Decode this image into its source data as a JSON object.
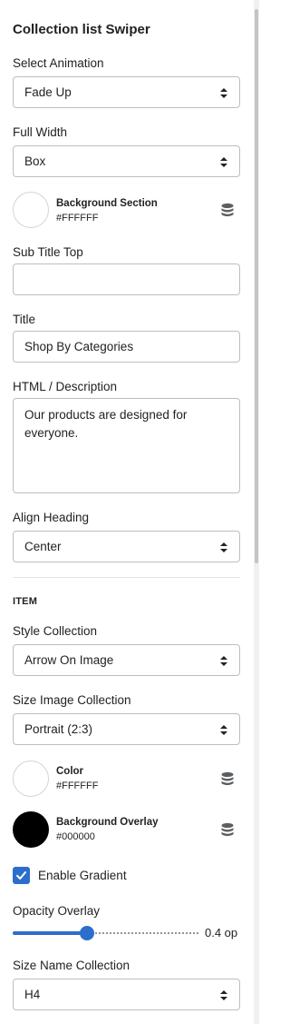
{
  "panel": {
    "title": "Collection list Swiper",
    "select_animation": {
      "label": "Select Animation",
      "value": "Fade Up"
    },
    "full_width": {
      "label": "Full Width",
      "value": "Box"
    },
    "background_section": {
      "label": "Background Section",
      "hex": "#FFFFFF",
      "color": "#ffffff"
    },
    "sub_title_top": {
      "label": "Sub Title Top",
      "value": ""
    },
    "title_field": {
      "label": "Title",
      "value": "Shop By Categories"
    },
    "html_description": {
      "label": "HTML / Description",
      "value": "Our products are designed for everyone."
    },
    "align_heading": {
      "label": "Align Heading",
      "value": "Center"
    },
    "item_section": "ITEM",
    "style_collection": {
      "label": "Style Collection",
      "value": "Arrow On Image"
    },
    "size_image_collection": {
      "label": "Size Image Collection",
      "value": "Portrait (2:3)"
    },
    "color": {
      "label": "Color",
      "hex": "#FFFFFF",
      "color": "#ffffff"
    },
    "background_overlay": {
      "label": "Background Overlay",
      "hex": "#000000",
      "color": "#000000"
    },
    "enable_gradient": {
      "label": "Enable Gradient",
      "checked": true
    },
    "opacity_overlay": {
      "label": "Opacity Overlay",
      "value": 0.4,
      "display": "0.4 op"
    },
    "size_name_collection": {
      "label": "Size Name Collection",
      "value": "H4"
    }
  },
  "colors": {
    "accent": "#2c6ecb",
    "border": "#babfc3"
  },
  "icons": {
    "select_arrows": "sort-arrows-icon",
    "dynamic_source": "database-icon",
    "check": "checkmark-icon"
  }
}
